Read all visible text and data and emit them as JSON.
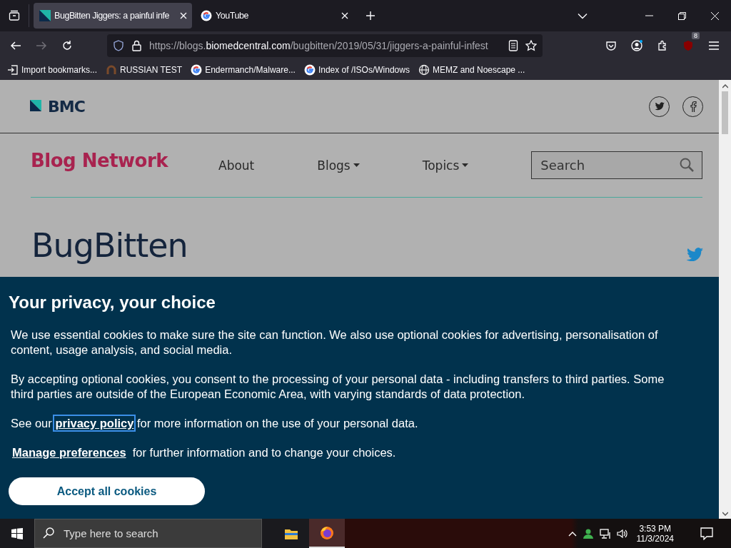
{
  "browser": {
    "tabs": [
      {
        "title": "BugBitten Jiggers: a painful infe",
        "kind": "bmc",
        "selected": true
      },
      {
        "title": "YouTube",
        "kind": "google",
        "selected": false
      }
    ],
    "url": {
      "prefix": "https://blogs.",
      "domain": "biomedcentral.com",
      "path": "/bugbitten/2019/05/31/jiggers-a-painful-infest"
    },
    "extension_badge": "8",
    "bookmarks": [
      {
        "label": "Import bookmarks...",
        "kind": "import"
      },
      {
        "label": "RUSSIAN TEST",
        "kind": "site"
      },
      {
        "label": "Endermanch/Malware...",
        "kind": "google"
      },
      {
        "label": "Index of /ISOs/Windows",
        "kind": "google"
      },
      {
        "label": "MEMZ and Noescape ...",
        "kind": "globe"
      }
    ]
  },
  "site": {
    "logo": "BMC",
    "network": "Blog Network",
    "nav": [
      {
        "label": "About",
        "dropdown": false
      },
      {
        "label": "Blogs",
        "dropdown": true
      },
      {
        "label": "Topics",
        "dropdown": true
      }
    ],
    "search": {
      "placeholder": "Search"
    },
    "blog_title": "BugBitten"
  },
  "cookie_banner": {
    "title": "Your privacy, your choice",
    "paragraphs": [
      "We use essential cookies to make sure the site can function. We also use optional cookies for advertising, personalisation of content, usage analysis, and social media.",
      "By accepting optional cookies, you consent to the processing of your personal data - including transfers to third parties. Some third parties are outside of the European Economic Area, with varying standards of data protection."
    ],
    "privacy": {
      "before": "See our",
      "link": "privacy policy",
      "focused": true,
      "after": "for more information on the use of your personal data."
    },
    "manage": {
      "link": "Manage preferences",
      "after": "for further information and to change your choices."
    },
    "accept": "Accept all cookies"
  },
  "taskbar": {
    "search": {
      "placeholder": "Type here to search"
    },
    "apps": [
      {
        "kind": "explorer",
        "selected": false
      },
      {
        "kind": "firefox",
        "selected": true
      }
    ],
    "time": "3:53 PM",
    "date": "11/3/2024"
  }
}
